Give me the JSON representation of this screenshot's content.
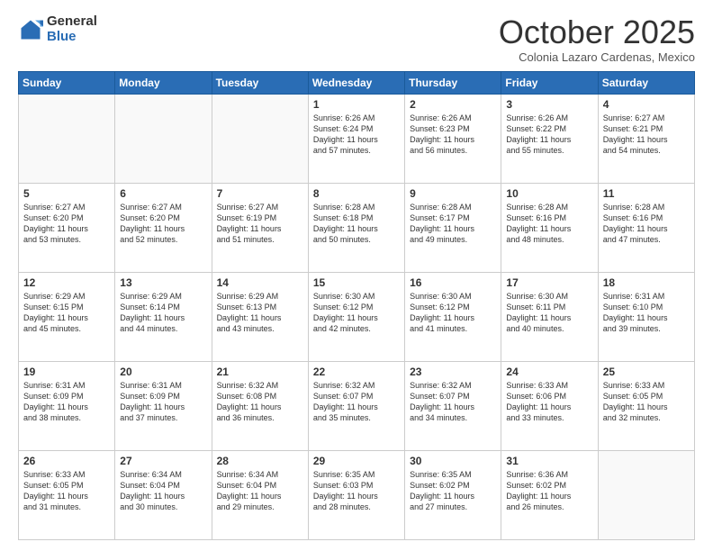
{
  "header": {
    "logo_general": "General",
    "logo_blue": "Blue",
    "month_title": "October 2025",
    "subtitle": "Colonia Lazaro Cardenas, Mexico"
  },
  "weekdays": [
    "Sunday",
    "Monday",
    "Tuesday",
    "Wednesday",
    "Thursday",
    "Friday",
    "Saturday"
  ],
  "weeks": [
    [
      {
        "day": "",
        "info": ""
      },
      {
        "day": "",
        "info": ""
      },
      {
        "day": "",
        "info": ""
      },
      {
        "day": "1",
        "info": "Sunrise: 6:26 AM\nSunset: 6:24 PM\nDaylight: 11 hours\nand 57 minutes."
      },
      {
        "day": "2",
        "info": "Sunrise: 6:26 AM\nSunset: 6:23 PM\nDaylight: 11 hours\nand 56 minutes."
      },
      {
        "day": "3",
        "info": "Sunrise: 6:26 AM\nSunset: 6:22 PM\nDaylight: 11 hours\nand 55 minutes."
      },
      {
        "day": "4",
        "info": "Sunrise: 6:27 AM\nSunset: 6:21 PM\nDaylight: 11 hours\nand 54 minutes."
      }
    ],
    [
      {
        "day": "5",
        "info": "Sunrise: 6:27 AM\nSunset: 6:20 PM\nDaylight: 11 hours\nand 53 minutes."
      },
      {
        "day": "6",
        "info": "Sunrise: 6:27 AM\nSunset: 6:20 PM\nDaylight: 11 hours\nand 52 minutes."
      },
      {
        "day": "7",
        "info": "Sunrise: 6:27 AM\nSunset: 6:19 PM\nDaylight: 11 hours\nand 51 minutes."
      },
      {
        "day": "8",
        "info": "Sunrise: 6:28 AM\nSunset: 6:18 PM\nDaylight: 11 hours\nand 50 minutes."
      },
      {
        "day": "9",
        "info": "Sunrise: 6:28 AM\nSunset: 6:17 PM\nDaylight: 11 hours\nand 49 minutes."
      },
      {
        "day": "10",
        "info": "Sunrise: 6:28 AM\nSunset: 6:16 PM\nDaylight: 11 hours\nand 48 minutes."
      },
      {
        "day": "11",
        "info": "Sunrise: 6:28 AM\nSunset: 6:16 PM\nDaylight: 11 hours\nand 47 minutes."
      }
    ],
    [
      {
        "day": "12",
        "info": "Sunrise: 6:29 AM\nSunset: 6:15 PM\nDaylight: 11 hours\nand 45 minutes."
      },
      {
        "day": "13",
        "info": "Sunrise: 6:29 AM\nSunset: 6:14 PM\nDaylight: 11 hours\nand 44 minutes."
      },
      {
        "day": "14",
        "info": "Sunrise: 6:29 AM\nSunset: 6:13 PM\nDaylight: 11 hours\nand 43 minutes."
      },
      {
        "day": "15",
        "info": "Sunrise: 6:30 AM\nSunset: 6:12 PM\nDaylight: 11 hours\nand 42 minutes."
      },
      {
        "day": "16",
        "info": "Sunrise: 6:30 AM\nSunset: 6:12 PM\nDaylight: 11 hours\nand 41 minutes."
      },
      {
        "day": "17",
        "info": "Sunrise: 6:30 AM\nSunset: 6:11 PM\nDaylight: 11 hours\nand 40 minutes."
      },
      {
        "day": "18",
        "info": "Sunrise: 6:31 AM\nSunset: 6:10 PM\nDaylight: 11 hours\nand 39 minutes."
      }
    ],
    [
      {
        "day": "19",
        "info": "Sunrise: 6:31 AM\nSunset: 6:09 PM\nDaylight: 11 hours\nand 38 minutes."
      },
      {
        "day": "20",
        "info": "Sunrise: 6:31 AM\nSunset: 6:09 PM\nDaylight: 11 hours\nand 37 minutes."
      },
      {
        "day": "21",
        "info": "Sunrise: 6:32 AM\nSunset: 6:08 PM\nDaylight: 11 hours\nand 36 minutes."
      },
      {
        "day": "22",
        "info": "Sunrise: 6:32 AM\nSunset: 6:07 PM\nDaylight: 11 hours\nand 35 minutes."
      },
      {
        "day": "23",
        "info": "Sunrise: 6:32 AM\nSunset: 6:07 PM\nDaylight: 11 hours\nand 34 minutes."
      },
      {
        "day": "24",
        "info": "Sunrise: 6:33 AM\nSunset: 6:06 PM\nDaylight: 11 hours\nand 33 minutes."
      },
      {
        "day": "25",
        "info": "Sunrise: 6:33 AM\nSunset: 6:05 PM\nDaylight: 11 hours\nand 32 minutes."
      }
    ],
    [
      {
        "day": "26",
        "info": "Sunrise: 6:33 AM\nSunset: 6:05 PM\nDaylight: 11 hours\nand 31 minutes."
      },
      {
        "day": "27",
        "info": "Sunrise: 6:34 AM\nSunset: 6:04 PM\nDaylight: 11 hours\nand 30 minutes."
      },
      {
        "day": "28",
        "info": "Sunrise: 6:34 AM\nSunset: 6:04 PM\nDaylight: 11 hours\nand 29 minutes."
      },
      {
        "day": "29",
        "info": "Sunrise: 6:35 AM\nSunset: 6:03 PM\nDaylight: 11 hours\nand 28 minutes."
      },
      {
        "day": "30",
        "info": "Sunrise: 6:35 AM\nSunset: 6:02 PM\nDaylight: 11 hours\nand 27 minutes."
      },
      {
        "day": "31",
        "info": "Sunrise: 6:36 AM\nSunset: 6:02 PM\nDaylight: 11 hours\nand 26 minutes."
      },
      {
        "day": "",
        "info": ""
      }
    ]
  ]
}
